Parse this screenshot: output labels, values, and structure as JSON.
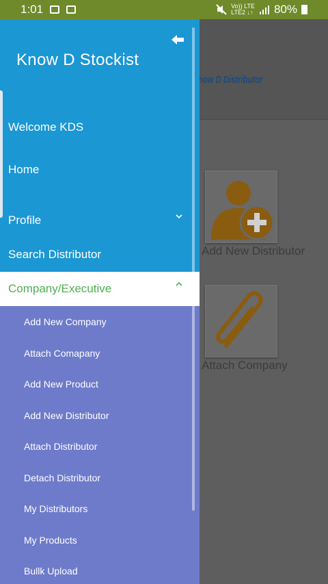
{
  "status_bar": {
    "time": "1:01",
    "net_top": "Vo)) LTE",
    "net_bottom": "LTE2 ↓↑",
    "battery_percent": "80%"
  },
  "background": {
    "logo_text": "now D Distributor",
    "tiles": [
      {
        "label": "Add New Distributor",
        "icon": "add-user-icon"
      },
      {
        "label": "Attach Company",
        "icon": "paperclip-icon"
      }
    ]
  },
  "drawer": {
    "app_title": "Know D Stockist",
    "welcome": "Welcome KDS",
    "items": [
      {
        "label": "Home"
      },
      {
        "label": "Profile"
      },
      {
        "label": "Search Distributor"
      }
    ],
    "active_section": "Company/Executive",
    "submenu": [
      "Add New Company",
      "Attach Comapany",
      "Add New Product",
      "Add New Distributor",
      "Attach Distributor",
      "Detach Distributor",
      "My Distributors",
      "My Products",
      "Bullk Upload"
    ]
  },
  "colors": {
    "status_bar": "#6e8a2a",
    "drawer_header": "#1b97d4",
    "drawer_submenu": "#6e7bcb",
    "active_text": "#4caf50",
    "icon_brown": "#b87a12"
  }
}
